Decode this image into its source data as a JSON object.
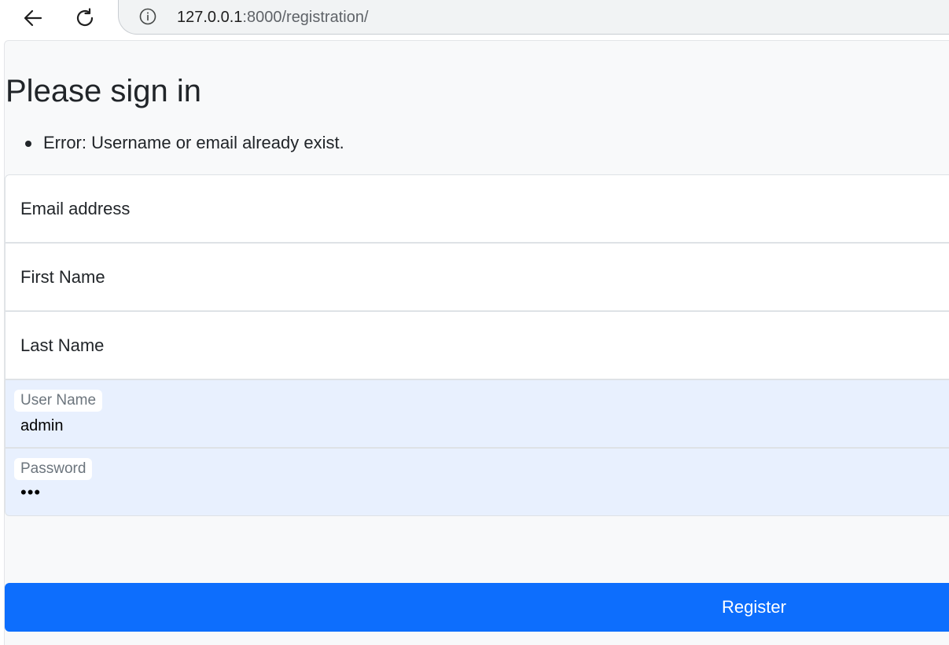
{
  "browser": {
    "url_host": "127.0.0.1",
    "url_rest": ":8000/registration/"
  },
  "page": {
    "heading": "Please sign in",
    "errors": [
      "Error: Username or email already exist."
    ]
  },
  "form": {
    "email": {
      "placeholder": "Email address"
    },
    "first_name": {
      "placeholder": "First Name"
    },
    "last_name": {
      "placeholder": "Last Name"
    },
    "username": {
      "label": "User Name",
      "value": "admin"
    },
    "password": {
      "label": "Password",
      "value": "•••"
    },
    "submit_label": "Register"
  },
  "colors": {
    "primary": "#0d6efd",
    "autofill_bg": "#e8f0fe",
    "page_bg": "#f8f9fa"
  }
}
